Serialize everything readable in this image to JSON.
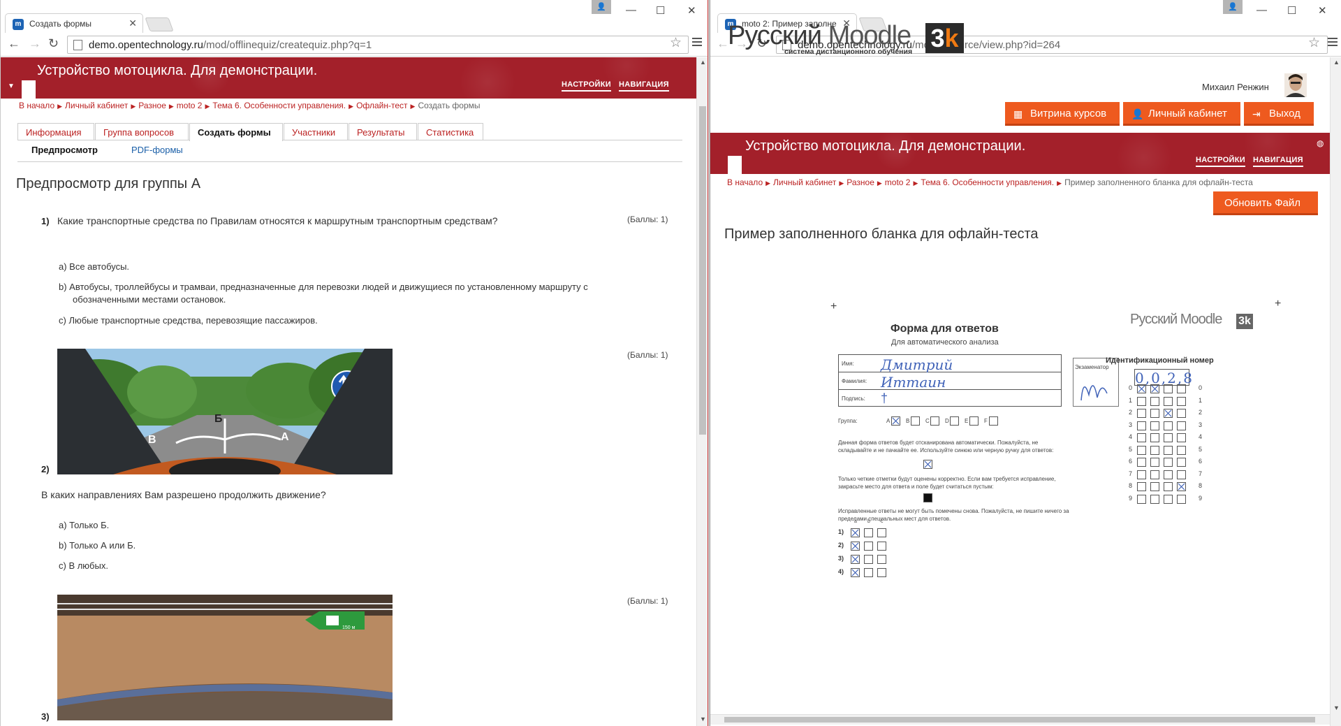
{
  "left": {
    "tab_title": "Создать формы",
    "url_domain": "demo.opentechnology.ru",
    "url_path": "/mod/offlinequiz/createquiz.php?q=1",
    "banner_title": "Устройство мотоцикла. Для демонстрации.",
    "nav_settings": "НАСТРОЙКИ",
    "nav_navigation": "НАВИГАЦИЯ",
    "breadcrumbs": [
      "В начало",
      "Личный кабинет",
      "Разное",
      "moto 2",
      "Тема 6. Особенности управления.",
      "Офлайн-тест"
    ],
    "breadcrumb_current": "Создать формы",
    "tabs": [
      "Информация",
      "Группа вопросов",
      "Создать формы",
      "Участники",
      "Результаты",
      "Статистика"
    ],
    "subtabs": [
      "Предпросмотр",
      "PDF-формы"
    ],
    "heading": "Предпросмотр для группы А",
    "points_label": "(Баллы: 1)",
    "questions": [
      {
        "num": "1)",
        "text": "Какие транспортные средства по Правилам относятся к маршрутным транспортным средствам?",
        "options": [
          "a)  Все автобусы.",
          "b)  Автобусы, троллейбусы и трамваи, предназначенные для перевозки людей и движущиеся по установленному маршруту с обозначенными местами остановок.",
          "c)  Любые транспортные средства, перевозящие пассажиров."
        ]
      },
      {
        "num": "2)",
        "text": "В каких направлениях Вам разрешено продолжить движение?",
        "options": [
          "a)  Только Б.",
          "b)  Только А или Б.",
          "c)  В любых."
        ],
        "image_labels": [
          "А",
          "Б",
          "В"
        ]
      },
      {
        "num": "3)"
      }
    ],
    "tunnel_sign": "150 м"
  },
  "right": {
    "tab_title": "moto 2: Пример заполне",
    "url_domain": "demo.opentechnology.ru",
    "url_path": "/mod/resource/view.php?id=264",
    "logo_text": "Русский",
    "logo_text2": "Moodle",
    "logo_badge": "3",
    "logo_badge2": "k",
    "logo_sub": "система дистанционного обучения",
    "user_name": "Михаил Ренжин",
    "buttons": [
      "Витрина курсов",
      "Личный кабинет",
      "Выход"
    ],
    "banner_title": "Устройство мотоцикла. Для демонстрации.",
    "nav_settings": "НАСТРОЙКИ",
    "nav_navigation": "НАВИГАЦИЯ",
    "breadcrumbs": [
      "В начало",
      "Личный кабинет",
      "Разное",
      "moto 2",
      "Тема 6. Особенности управления."
    ],
    "breadcrumb_current": "Пример заполненного бланка для офлайн-теста",
    "update_button": "Обновить Файл",
    "heading": "Пример заполненного бланка для офлайн-теста",
    "form": {
      "title": "Форма для ответов",
      "subtitle": "Для автоматического анализа",
      "field_name": "Имя:",
      "field_surname": "Фамилия:",
      "field_signature": "Подпись:",
      "name_value": "Дмитрий",
      "surname_value": "Иттаин",
      "examiner": "Экзаменатор",
      "id_title": "Идентификационный номер",
      "id_value": "0,0,2,8",
      "group_label": "Группа:",
      "groups": [
        "A",
        "B",
        "C",
        "D",
        "E",
        "F"
      ],
      "instr1": "Данная форма ответов будет отсканирована автоматически. Пожалуйста, не складывайте и не пачкайте ее. Используйте синюю или черную ручку для ответов:",
      "instr2": "Только четкие отметки будут оценены корректно. Если вам требуется исправление, закрасьте место для ответа и поле будет считаться пустым:",
      "instr3": "Исправленные ответы не могут быть помечены снова. Пожалуйста, не пишите ничего за пределами специальных мест для ответов.",
      "answer_cols": [
        "a",
        "b",
        "c"
      ],
      "answer_rows": [
        "1)",
        "2)",
        "3)",
        "4)"
      ],
      "digits": [
        "0",
        "1",
        "2",
        "3",
        "4",
        "5",
        "6",
        "7",
        "8",
        "9"
      ]
    }
  }
}
